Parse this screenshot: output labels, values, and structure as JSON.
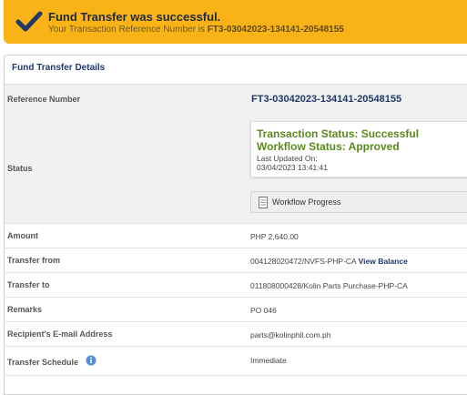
{
  "banner": {
    "title": "Fund Transfer was successful.",
    "ref_prefix": "Your Transaction Reference Number is ",
    "ref_number": "FT3-03042023-134141-20548155"
  },
  "panel": {
    "title": "Fund Transfer Details"
  },
  "details": {
    "reference": {
      "label": "Reference Number",
      "value": "FT3-03042023-134141-20548155"
    },
    "status": {
      "label": "Status",
      "transaction": "Transaction Status: Successful",
      "workflow": "Workflow Status: Approved",
      "updated_label": "Last Updated On:",
      "updated_value": "03/04/2023 13:41:41",
      "button_label": "Workflow Progress"
    },
    "amount": {
      "label": "Amount",
      "value": "PHP 2,640.00"
    },
    "transfer_from": {
      "label": "Transfer from",
      "value": "004128020472/NVFS-PHP-CA",
      "link": "View Balance"
    },
    "transfer_to": {
      "label": "Transfer to",
      "value": "011808000428/Kolin Parts Purchase-PHP-CA"
    },
    "remarks": {
      "label": "Remarks",
      "value": "PO 046"
    },
    "email": {
      "label": "Recipient's E-mail Address",
      "value": "parts@kolinphil.com.ph"
    },
    "schedule": {
      "label": "Transfer Schedule",
      "value": "Immediate"
    }
  },
  "colors": {
    "banner": "#f9b317",
    "success_text": "#5a8a1e",
    "link": "#1f3a68"
  }
}
